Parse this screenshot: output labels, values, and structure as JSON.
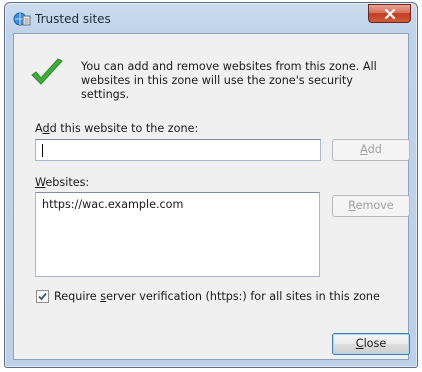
{
  "window": {
    "title": "Trusted sites",
    "close_glyph": "x"
  },
  "info": {
    "text": "You can add and remove websites from this zone. All websites in this zone will use the zone's security settings.",
    "icon": "green-checkmark-icon"
  },
  "add_site": {
    "label_prefix": "A",
    "label_access_key": "d",
    "label_rest": "d this website to the zone:",
    "input_value": "",
    "add_button_access_key": "A",
    "add_button_rest": "dd"
  },
  "websites": {
    "label_access_key": "W",
    "label_rest": "ebsites:",
    "items": [
      "https://wac.example.com"
    ],
    "remove_button_access_key": "R",
    "remove_button_rest": "emove"
  },
  "verification": {
    "checked": true,
    "label_prefix": "Require ",
    "label_access_key": "s",
    "label_rest": "erver verification (https:) for all sites in this zone"
  },
  "footer": {
    "close_access_key": "C",
    "close_rest": "lose"
  }
}
